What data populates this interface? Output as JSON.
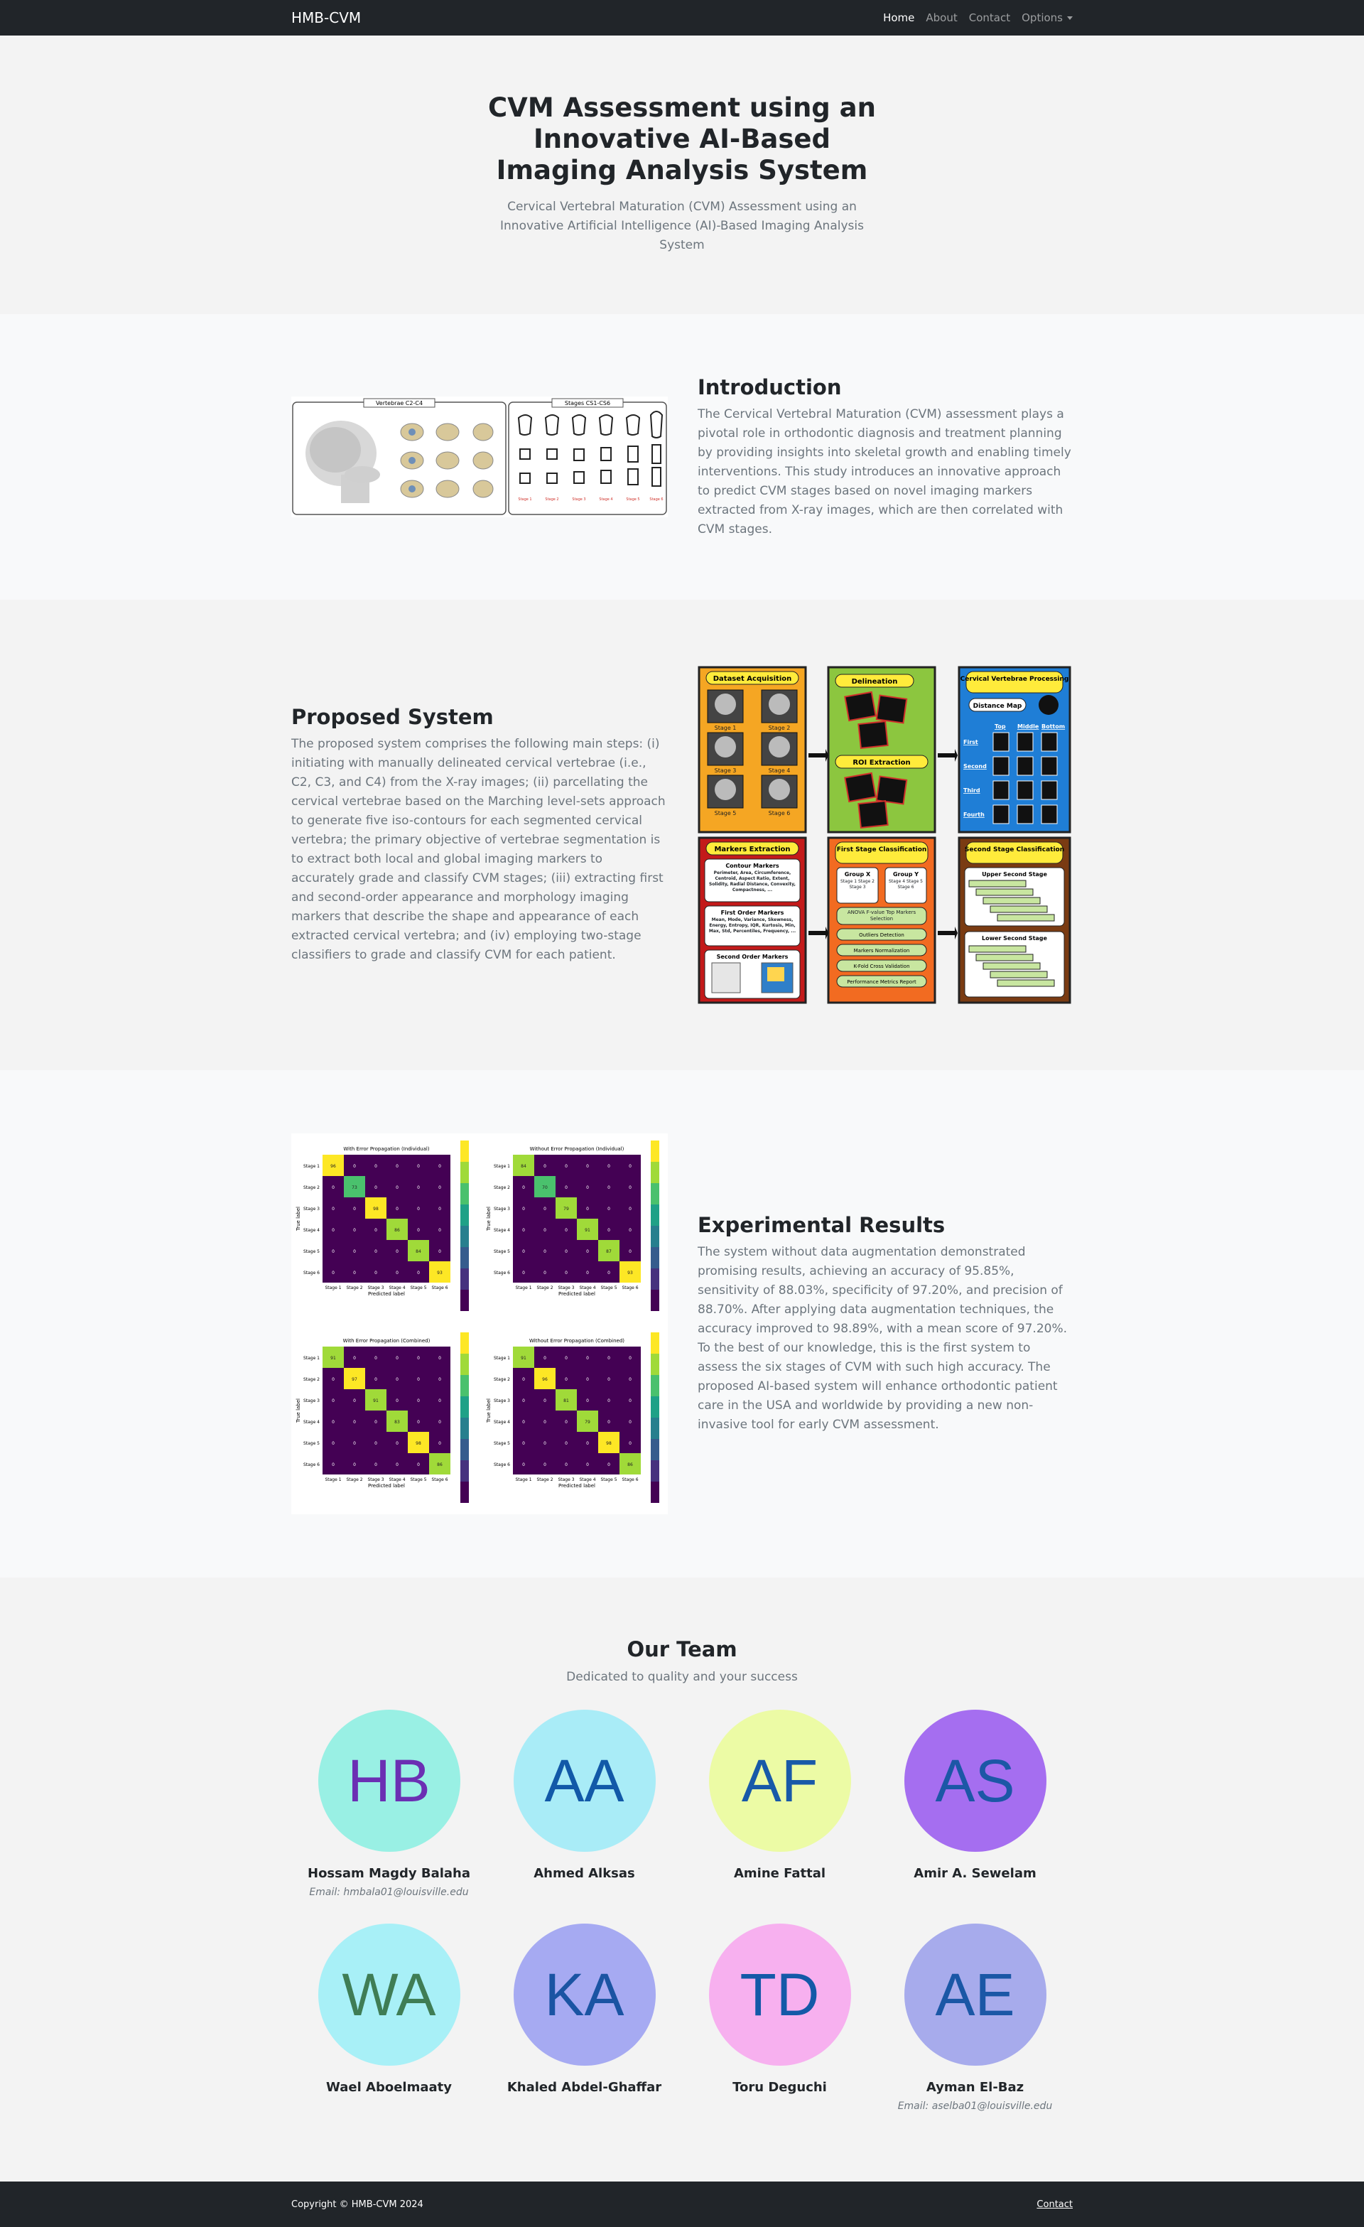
{
  "navbar": {
    "brand": "HMB-CVM",
    "links": [
      {
        "label": "Home"
      },
      {
        "label": "About"
      },
      {
        "label": "Contact"
      },
      {
        "label": "Options"
      }
    ]
  },
  "hero": {
    "title": "CVM Assessment using an Innovative AI-Based Imaging Analysis System",
    "subtitle": "Cervical Vertebral Maturation (CVM) Assessment using an Innovative Artificial Intelligence (AI)-Based Imaging Analysis System"
  },
  "intro": {
    "title": "Introduction",
    "text": "The Cervical Vertebral Maturation (CVM) assessment plays a pivotal role in orthodontic diagnosis and treatment planning by providing insights into skeletal growth and enabling timely interventions. This study introduces an innovative approach to predict CVM stages based on novel imaging markers extracted from X-ray images, which are then correlated with CVM stages.",
    "figure": {
      "left_title": "Vertebrae C2-C4",
      "right_title": "Stages CS1-CS6",
      "stage_labels": [
        "Stage 1",
        "Stage 2",
        "Stage 3",
        "Stage 4",
        "Stage 5",
        "Stage 6"
      ]
    }
  },
  "proposed": {
    "title": "Proposed System",
    "text": "The proposed system comprises the following main steps: (i) initiating with manually delineated cervical vertebrae (i.e., C2, C3, and C4) from the X-ray images; (ii) parcellating the cervical vertebrae based on the Marching level-sets approach to generate five iso-contours for each segmented cervical vertebra; the primary objective of vertebrae segmentation is to extract both local and global imaging markers to accurately grade and classify CVM stages; (iii) extracting first and second-order appearance and morphology imaging markers that describe the shape and appearance of each extracted cervical vertebra; and (iv) employing two-stage classifiers to grade and classify CVM for each patient.",
    "diagram": {
      "dataset": "Dataset Acquisition",
      "delineation": "Delineation",
      "roi": "ROI Extraction",
      "processing": "Cervical Vertebrae Processing",
      "distance_map": "Distance Map",
      "cols": [
        "Top",
        "Middle",
        "Bottom"
      ],
      "rows": [
        "First",
        "Second",
        "Third",
        "Fourth"
      ],
      "markers": "Markers Extraction",
      "contour_markers": "Contour Markers",
      "contour_text": "Perimeter, Area, Circumference, Centroid, Aspect Ratio, Extent, Solidity, Radial Distance, Convexity, Compactness, ...",
      "first_order": "First Order Markers",
      "first_order_text": "Mean, Mode, Variance, Skewness, Energy, Entropy, IQR, Kurtosis, Min, Max, Std, Percentiles, Frequency, ...",
      "second_order": "Second Order Markers",
      "first_stage": "First Stage Classification",
      "group_x": "Group X",
      "group_x_stages": "Stage 1 Stage 2 Stage 3",
      "group_y": "Group Y",
      "group_y_stages": "Stage 4 Stage 5 Stage 6",
      "fs_steps": [
        "ANOVA F-value Top Markers Selection",
        "Outliers Detection",
        "Markers Normalization",
        "K-Fold Cross Validation",
        "Performance Metrics Report"
      ],
      "second_stage": "Second Stage Classification",
      "upper": "Upper Second Stage",
      "lower": "Lower Second Stage",
      "stage_labels": [
        "Stage 1",
        "Stage 2",
        "Stage 3",
        "Stage 4",
        "Stage 5",
        "Stage 6"
      ]
    }
  },
  "results": {
    "title": "Experimental Results",
    "text": "The system without data augmentation demonstrated promising results, achieving an accuracy of 95.85%, sensitivity of 88.03%, specificity of 97.20%, and precision of 88.70%. After applying data augmentation techniques, the accuracy improved to 98.89%, with a mean score of 97.20%. To the best of our knowledge, this is the first system to assess the six stages of CVM with such high accuracy. The proposed AI-based system will enhance orthodontic patient care in the USA and worldwide by providing a new non-invasive tool for early CVM assessment.",
    "matrices": [
      {
        "title": "With Error Propagation (Individual)",
        "diag": [
          96,
          73,
          98,
          86,
          84,
          93
        ]
      },
      {
        "title": "Without Error Propagation (Individual)",
        "diag": [
          84,
          70,
          79,
          91,
          87,
          93
        ]
      },
      {
        "title": "With Error Propagation (Combined)",
        "diag": [
          91,
          97,
          91,
          83,
          98,
          86
        ]
      },
      {
        "title": "Without Error Propagation (Combined)",
        "diag": [
          91,
          96,
          81,
          79,
          98,
          86
        ]
      }
    ],
    "xlabel": "Predicted label",
    "ylabel": "True label",
    "stage_labels": [
      "Stage 1",
      "Stage 2",
      "Stage 3",
      "Stage 4",
      "Stage 5",
      "Stage 6"
    ]
  },
  "team": {
    "title": "Our Team",
    "lead": "Dedicated to quality and your success",
    "members": [
      {
        "initials": "HB",
        "name": "Hossam Magdy Balaha",
        "email": "Email: hmbala01@louisville.edu",
        "bg": "#99f0e4",
        "fg": "#6b2fb3"
      },
      {
        "initials": "AA",
        "name": "Ahmed Alksas",
        "email": "",
        "bg": "#a9ecf7",
        "fg": "#1259a8"
      },
      {
        "initials": "AF",
        "name": "Amine Fattal",
        "email": "",
        "bg": "#ecfba5",
        "fg": "#1859a8"
      },
      {
        "initials": "AS",
        "name": "Amir A. Sewelam",
        "email": "",
        "bg": "#a56ef0",
        "fg": "#1c57a6"
      },
      {
        "initials": "WA",
        "name": "Wael Aboelmaaty",
        "email": "",
        "bg": "#a8f0f7",
        "fg": "#3f7d55"
      },
      {
        "initials": "KA",
        "name": "Khaled Abdel-Ghaffar",
        "email": "",
        "bg": "#a6aaf2",
        "fg": "#1a54a3"
      },
      {
        "initials": "TD",
        "name": "Toru Deguchi",
        "email": "",
        "bg": "#f7b0ef",
        "fg": "#1459a8"
      },
      {
        "initials": "AE",
        "name": "Ayman El-Baz",
        "email": "Email: aselba01@louisville.edu",
        "bg": "#a7abec",
        "fg": "#1a57a6"
      }
    ]
  },
  "footer": {
    "copyright": "Copyright © HMB-CVM 2024",
    "contact": "Contact"
  }
}
